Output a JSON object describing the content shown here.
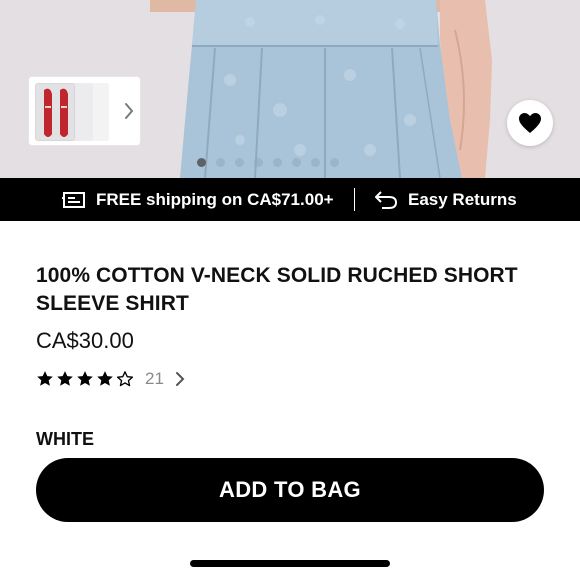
{
  "gallery": {
    "dots_total": 8,
    "active_dot": 0,
    "thumbnail_next": "chevron-right-icon"
  },
  "promo": {
    "shipping_text": "FREE shipping on CA$71.00+",
    "returns_text": "Easy Returns",
    "shipping_icon": "truck-icon",
    "returns_icon": "return-arrow-icon"
  },
  "product": {
    "title": "100% COTTON V-NECK SOLID RUCHED SHORT SLEEVE SHIRT",
    "price": "CA$30.00",
    "rating": 4,
    "rating_max": 5,
    "review_count": "21",
    "color": "WHITE"
  },
  "actions": {
    "add_to_bag": "ADD TO BAG",
    "favorite_icon": "heart-icon"
  },
  "colors": {
    "accent": "#000000",
    "skirt": "#a9c3d8",
    "shoe": "#c0262e"
  }
}
